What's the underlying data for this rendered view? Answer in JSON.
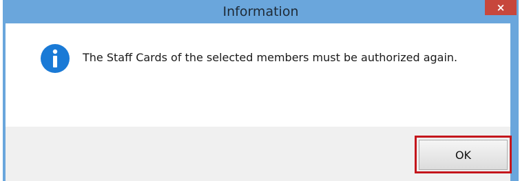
{
  "dialog": {
    "title": "Information",
    "close_label": "×",
    "message": "The Staff Cards of the selected members must be authorized again.",
    "icon": "info-icon",
    "ok_label": "OK"
  },
  "colors": {
    "titlebar": "#6aa6dc",
    "close_button": "#c7473c",
    "info_icon": "#1a7ad6",
    "highlight": "#c4161c",
    "footer": "#f0f0f0"
  }
}
